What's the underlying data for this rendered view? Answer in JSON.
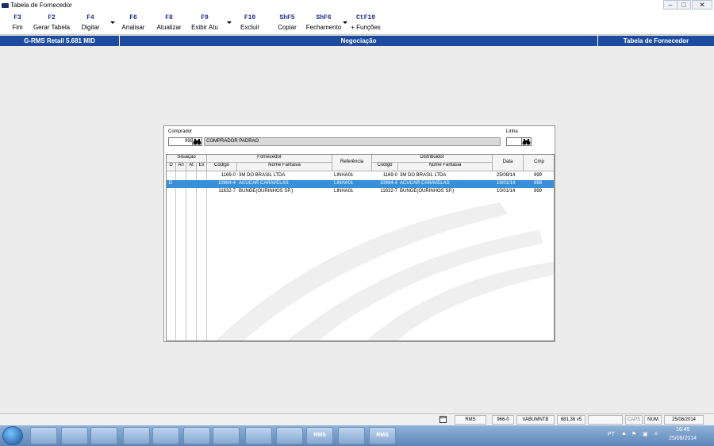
{
  "window": {
    "title": "Tabela de Fornecedor"
  },
  "toolbar": [
    {
      "key": "F3",
      "label": "Fim",
      "dropdown": false
    },
    {
      "key": "F2",
      "label": "Gerar Tabela",
      "dropdown": false
    },
    {
      "key": "F4",
      "label": "Digitar",
      "dropdown": true
    },
    {
      "key": "F6",
      "label": "Analisar",
      "dropdown": false
    },
    {
      "key": "F8",
      "label": "Atualizar",
      "dropdown": false
    },
    {
      "key": "F9",
      "label": "Exibir Atu",
      "dropdown": true
    },
    {
      "key": "F10",
      "label": "Excluir",
      "dropdown": false
    },
    {
      "key": "ShF5",
      "label": "Copiar",
      "dropdown": false
    },
    {
      "key": "ShF6",
      "label": "Fechamento",
      "dropdown": true
    },
    {
      "key": "CtF10",
      "label": "+ Funções",
      "dropdown": false
    }
  ],
  "infobar": {
    "system": "G-RMS Retail 5.681 MID",
    "module": "Negociação",
    "screen": "Tabela de Fornecedor"
  },
  "form": {
    "comprador_label": "Comprador",
    "comprador_code": "999",
    "comprador_name": "COMPRADOR PADRAO",
    "linha_label": "Linha",
    "linha_value": ""
  },
  "grid": {
    "group_headers": {
      "situacao": "Situação",
      "fornecedor": "Fornecedor",
      "referencia": "Referência",
      "distribuidor": "Distribuidor",
      "data": "Data",
      "cmp": "Cmp"
    },
    "sub_headers": {
      "d": "D",
      "an": "An",
      "at": "At",
      "ex": "Ex",
      "forn_codigo": "Código",
      "forn_nome": "Nome Fantasia",
      "dist_codigo": "Código",
      "dist_nome": "Nome Fantasia"
    },
    "rows": [
      {
        "d": "",
        "an": "",
        "at": "",
        "ex": "",
        "forn_codigo": "1169-0",
        "forn_nome": "3M DO BRASIL LTDA",
        "referencia": "LINHA01",
        "dist_codigo": "1169-0",
        "dist_nome": "3M DO BRASIL LTDA",
        "data": "25/08/14",
        "cmp": "999",
        "selected": false
      },
      {
        "d": "D",
        "an": "",
        "at": "",
        "ex": "",
        "forn_codigo": "10894-4",
        "forn_nome": "ACUCAR CARAVELAS",
        "referencia": "LINHA01",
        "dist_codigo": "10894-4",
        "dist_nome": "ACUCAR CARAVELAS",
        "data": "10/01/14",
        "cmp": "999",
        "selected": true
      },
      {
        "d": "",
        "an": "",
        "at": "",
        "ex": "",
        "forn_codigo": "11632-7",
        "forn_nome": "BUNGE(OURINHOS SP.)",
        "referencia": "LINHA01",
        "dist_codigo": "11632-7",
        "dist_nome": "BUNGE(OURINHOS SP.)",
        "data": "10/01/14",
        "cmp": "999",
        "selected": false
      }
    ]
  },
  "statusbar": {
    "rms": "RMS",
    "code": "966-0",
    "user": "VABUMNTB",
    "version": "681.36 v5",
    "caps": "CAPS",
    "num": "NUM",
    "date": "25/08/2014"
  },
  "taskbar": {
    "apps": [
      {
        "icon": "internet-explorer-icon",
        "text": ""
      },
      {
        "icon": "explorer-folder-icon",
        "text": ""
      },
      {
        "icon": "media-player-icon",
        "text": ""
      },
      {
        "icon": "outlook-icon",
        "text": ""
      },
      {
        "icon": "lync-icon",
        "text": ""
      },
      {
        "icon": "link-icon",
        "text": ""
      },
      {
        "icon": "word-icon",
        "text": ""
      },
      {
        "icon": "plus-app-icon",
        "text": ""
      },
      {
        "icon": "remote-desktop-icon",
        "text": ""
      },
      {
        "icon": "rms-icon",
        "text": "RMS"
      },
      {
        "icon": "pdf-icon",
        "text": ""
      },
      {
        "icon": "rms-icon",
        "text": "RMS"
      }
    ],
    "lang": "PT",
    "time": "16:45",
    "date": "25/08/2014"
  },
  "colors": {
    "infobar": "#1d4c9e",
    "selection": "#3b8ed8",
    "toolbar_key": "#1c2f8a"
  }
}
